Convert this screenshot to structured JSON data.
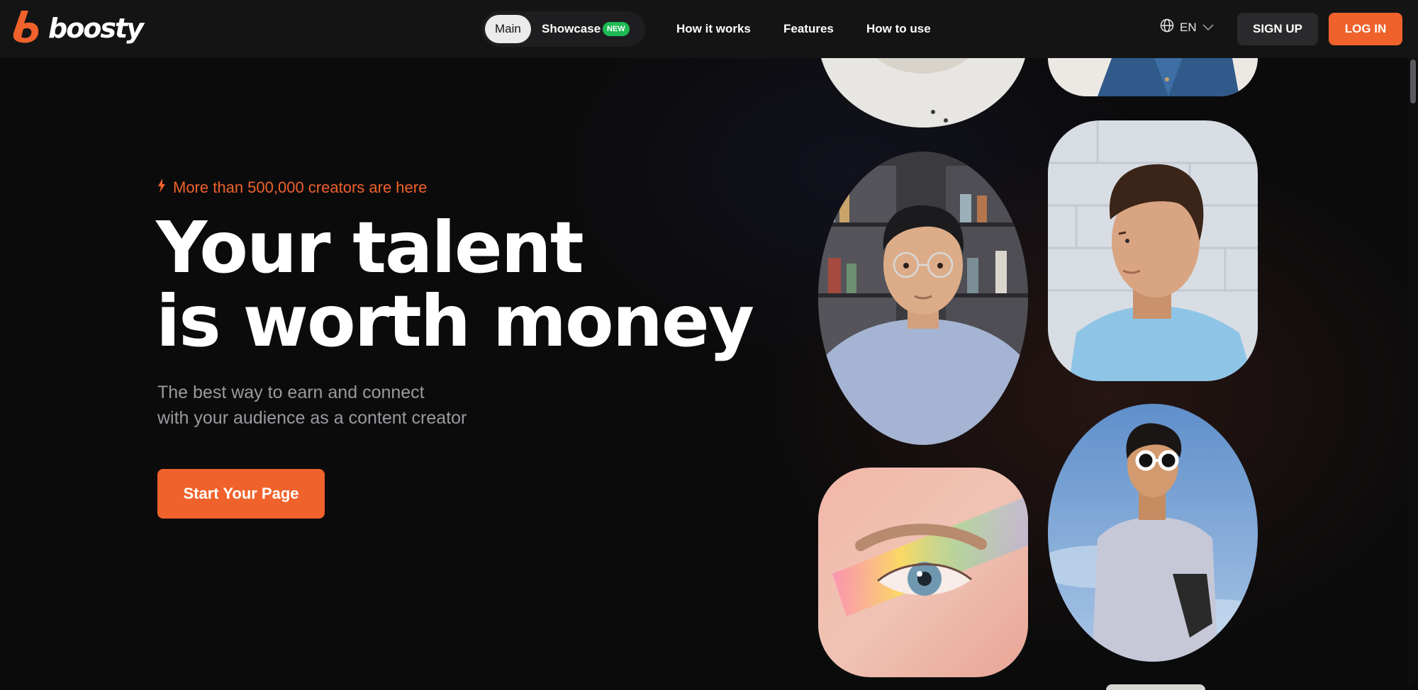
{
  "header": {
    "logo_text": "boosty",
    "nav_tabs": [
      {
        "label": "Main",
        "active": true
      },
      {
        "label": "Showcase",
        "badge": "NEW"
      }
    ],
    "nav_links": [
      "How it works",
      "Features",
      "How to use"
    ],
    "language": "EN",
    "signup_label": "SIGN UP",
    "login_label": "LOG IN"
  },
  "hero": {
    "tagline": "More than 500,000 creators are here",
    "headline_line1": "Your talent",
    "headline_line2": "is worth money",
    "subtitle_line1": "The best way to earn and connect",
    "subtitle_line2": "with your audience as a content creator",
    "cta_label": "Start Your Page"
  },
  "icons": {
    "logo": "lightning-b-logo-icon",
    "tagline": "lightning-icon",
    "language": "globe-icon",
    "language_dropdown": "chevron-down-icon"
  },
  "colors": {
    "accent": "#f0622b",
    "badge_new": "#1db954",
    "background": "#0b0b0c",
    "header": "#141415"
  },
  "photos": [
    "creator-photo-top-left",
    "creator-photo-top-right",
    "creator-photo-man-glasses",
    "creator-photo-man-profile",
    "creator-photo-eye-closeup",
    "creator-photo-man-sunglasses"
  ]
}
